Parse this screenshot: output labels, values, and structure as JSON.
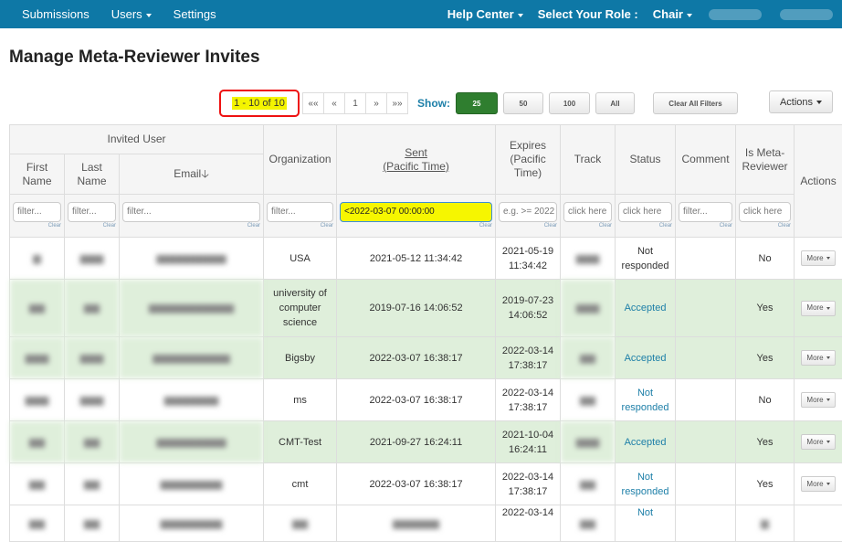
{
  "nav": {
    "submissions": "Submissions",
    "users": "Users",
    "settings": "Settings",
    "help_center": "Help Center",
    "select_role": "Select Your Role :",
    "role": "Chair"
  },
  "page": {
    "title": "Manage Meta-Reviewer Invites"
  },
  "pagination": {
    "range": "1 - 10 of 10",
    "first": "««",
    "prev": "«",
    "page": "1",
    "next": "»",
    "last": "»»"
  },
  "show": {
    "label": "Show:",
    "opt_25": "25",
    "opt_50": "50",
    "opt_100": "100",
    "opt_all": "All"
  },
  "toolbar": {
    "clear_filters": "Clear All Filters",
    "actions": "Actions"
  },
  "table": {
    "group_header": "Invited User",
    "headers": {
      "first_name": "First Name",
      "last_name": "Last Name",
      "email": "Email",
      "organization": "Organization",
      "sent_line1": "Sent",
      "sent_line2": "(Pacific Time)",
      "expires": "Expires (Pacific Time)",
      "track": "Track",
      "status": "Status",
      "comment": "Comment",
      "is_meta": "Is Meta-Reviewer",
      "actions": "Actions"
    },
    "filters": {
      "first_name": "filter...",
      "last_name": "filter...",
      "email": "filter...",
      "organization": "filter...",
      "sent": "<2022-03-07 00:00:00",
      "expires": "e.g. >= 2022",
      "track": "click here",
      "status": "click here",
      "comment": "filter...",
      "is_meta": "click here",
      "clear": "Clear"
    },
    "more_label": "More",
    "rows": [
      {
        "org": "USA",
        "sent": "2021-05-12 11:34:42",
        "exp_date": "2021-05-19",
        "exp_time": "11:34:42",
        "status_l1": "Not",
        "status_l2": "responded",
        "status_type": "plain",
        "is_meta": "No"
      },
      {
        "org_l1": "university of",
        "org_l2": "computer",
        "org_l3": "science",
        "sent": "2019-07-16 14:06:52",
        "exp_date": "2019-07-23",
        "exp_time": "14:06:52",
        "status_l1": "Accepted",
        "status_type": "accepted",
        "is_meta": "Yes"
      },
      {
        "org": "Bigsby",
        "sent": "2022-03-07 16:38:17",
        "exp_date": "2022-03-14",
        "exp_time": "17:38:17",
        "status_l1": "Accepted",
        "status_type": "accepted",
        "is_meta": "Yes"
      },
      {
        "org": "ms",
        "sent": "2022-03-07 16:38:17",
        "exp_date": "2022-03-14",
        "exp_time": "17:38:17",
        "status_l1": "Not",
        "status_l2": "responded",
        "status_type": "not",
        "is_meta": "No"
      },
      {
        "org": "CMT-Test",
        "sent": "2021-09-27 16:24:11",
        "exp_date": "2021-10-04",
        "exp_time": "16:24:11",
        "status_l1": "Accepted",
        "status_type": "accepted",
        "is_meta": "Yes"
      },
      {
        "org": "cmt",
        "sent": "2022-03-07 16:38:17",
        "exp_date": "2022-03-14",
        "exp_time": "17:38:17",
        "status_l1": "Not",
        "status_l2": "responded",
        "status_type": "not",
        "is_meta": "Yes"
      },
      {
        "exp_date": "2022-03-14",
        "status_l1": "Not"
      }
    ]
  }
}
